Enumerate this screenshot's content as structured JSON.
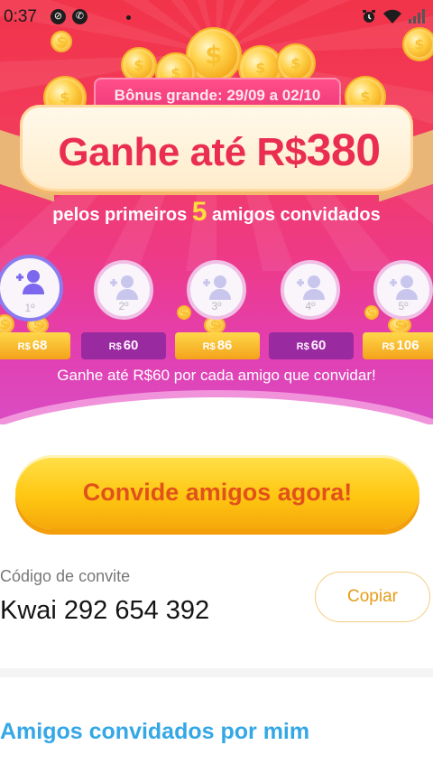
{
  "status_bar": {
    "time": "0:37",
    "icons": [
      "blocked-icon",
      "whatsapp-icon",
      "notification-dot-icon",
      "alarm-icon",
      "wifi-icon",
      "signal-icon"
    ]
  },
  "hero": {
    "bonus_period": "Bônus grande: 29/09 a 02/10",
    "headline_prefix": "Ganhe até R$",
    "headline_amount": "380",
    "subtitle_before": "pelos primeiros",
    "subtitle_count": "5",
    "subtitle_after": "amigos convidados",
    "slots": [
      {
        "rank": "1º",
        "currency": "R$",
        "amount": "68",
        "style": "gold"
      },
      {
        "rank": "2º",
        "currency": "R$",
        "amount": "60",
        "style": "purple"
      },
      {
        "rank": "3º",
        "currency": "R$",
        "amount": "86",
        "style": "gold"
      },
      {
        "rank": "4º",
        "currency": "R$",
        "amount": "60",
        "style": "purple"
      },
      {
        "rank": "5º",
        "currency": "R$",
        "amount": "106",
        "style": "gold"
      }
    ],
    "earn_line": "Ganhe até R$60 por cada amigo que convidar!"
  },
  "cta": {
    "label": "Convide amigos agora!"
  },
  "invite_code": {
    "label": "Código de convite",
    "value": "Kwai 292 654 392",
    "copy_label": "Copiar"
  },
  "friends_section": {
    "title": "Amigos convidados por mim"
  },
  "colors": {
    "accent_red": "#ea2e52",
    "cta_yellow": "#ffc712",
    "cta_text": "#e0521a",
    "section_blue": "#34a7e6",
    "copy_orange": "#e59d1a"
  }
}
